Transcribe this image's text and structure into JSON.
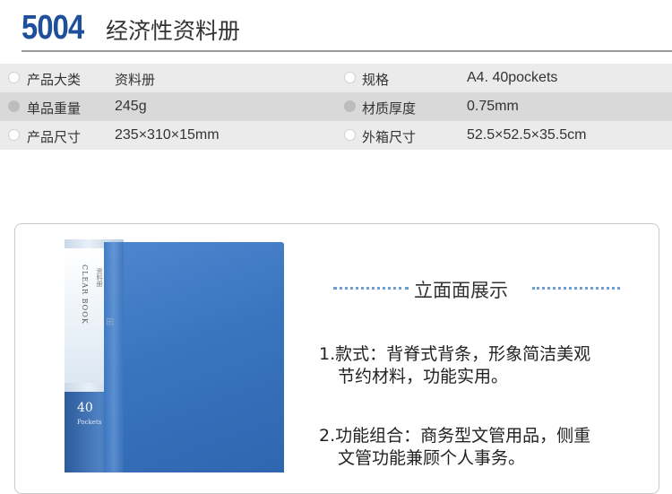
{
  "title": {
    "model": "5004",
    "name": "经济性资料册"
  },
  "specs": [
    {
      "label_a": "产品大类",
      "value_a": "资料册",
      "label_b": "规格",
      "value_b": "A4. 40pockets"
    },
    {
      "label_a": "单品重量",
      "value_a": "245g",
      "label_b": "材质厚度",
      "value_b": "0.75mm"
    },
    {
      "label_a": "产品尺寸",
      "value_a": "235×310×15mm",
      "label_b": "外箱尺寸",
      "value_b": "52.5×52.5×35.5cm"
    }
  ],
  "product": {
    "spine_text": "CLEAR BOOK",
    "spine_sub": "资料册",
    "spine_num": "40",
    "spine_num_sub": "Pockets"
  },
  "display": {
    "heading": "立面面展示",
    "feature1_line1": "1.款式：背脊式背条，形象简洁美观",
    "feature1_line2": "节约材料，功能实用。",
    "feature2_line1": "2.功能组合：商务型文管用品，侧重",
    "feature2_line2": "文管功能兼顾个人事务。"
  },
  "colors": {
    "model": "#1d4f9a",
    "binder": "#3a74bf",
    "dots": "#6b9fd6"
  }
}
